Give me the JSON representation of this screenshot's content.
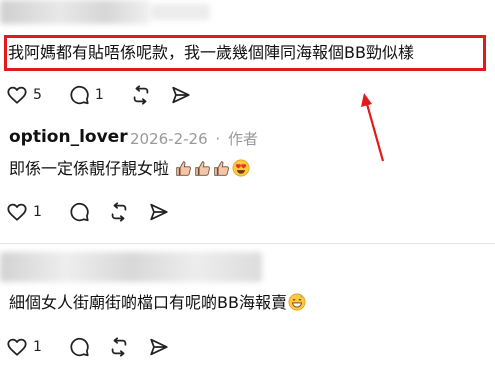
{
  "comment_1": {
    "text": "我阿媽都有貼唔係呢款，我一歲幾個陣同海報個BB勁似樣",
    "like_count": "5",
    "reply_count": "1"
  },
  "comment_2": {
    "username": "option_lover",
    "date": "2026-2-26",
    "separator": "·",
    "author_tag": "作者",
    "text": "即係一定係靚仔靚女啦",
    "like_count": "1"
  },
  "comment_3": {
    "text": "細個女人街廟街啲檔口有呢啲BB海報賣",
    "like_count": "1"
  },
  "colors": {
    "highlight_border": "#e21a1a",
    "arrow": "#e21a1a",
    "meta_text": "#999999",
    "divider": "#e2e2e2"
  },
  "icons": [
    "heart-icon",
    "comment-icon",
    "repost-icon",
    "share-icon",
    "thumbs-up-emoji",
    "heart-eyes-emoji"
  ]
}
